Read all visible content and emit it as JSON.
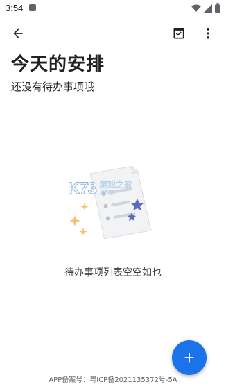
{
  "status_bar": {
    "time": "3:54"
  },
  "header": {
    "title": "今天的安排",
    "subtitle": "还没有待办事项哦"
  },
  "empty_state": {
    "message": "待办事项列表空空如也"
  },
  "watermark": {
    "logo": "K73",
    "cn": "游戏之家",
    "en": ".com"
  },
  "footer": {
    "text": "APP备案号：粤ICP备2021135372号-5A"
  },
  "icons": {
    "back": "arrow-back-icon",
    "check": "check-box-icon",
    "more": "more-vert-icon",
    "fab": "plus-icon"
  },
  "colors": {
    "accent": "#1a73e8",
    "text": "#202124",
    "muted": "#5f6368"
  }
}
